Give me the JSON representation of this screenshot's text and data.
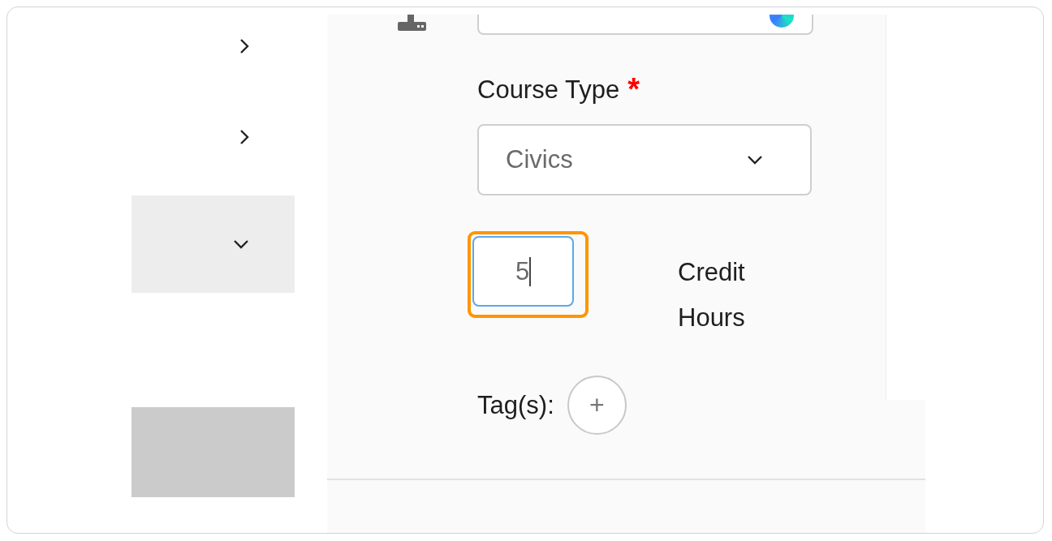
{
  "sidebar": {
    "items": [
      {
        "kind": "row",
        "expanded": false,
        "selected": false
      },
      {
        "kind": "row",
        "expanded": false,
        "selected": false
      },
      {
        "kind": "row",
        "expanded": true,
        "selected": true
      },
      {
        "kind": "block"
      }
    ]
  },
  "form": {
    "top_field": {
      "kind": "cut"
    },
    "course_type": {
      "label": "Course Type",
      "required": true,
      "required_mark": "*",
      "value": "Civics"
    },
    "credit_hours": {
      "value": "5",
      "focused": true,
      "highlighted": true,
      "label": "Credit Hours"
    },
    "tags": {
      "label": "Tag(s):",
      "add_button": "+"
    }
  }
}
